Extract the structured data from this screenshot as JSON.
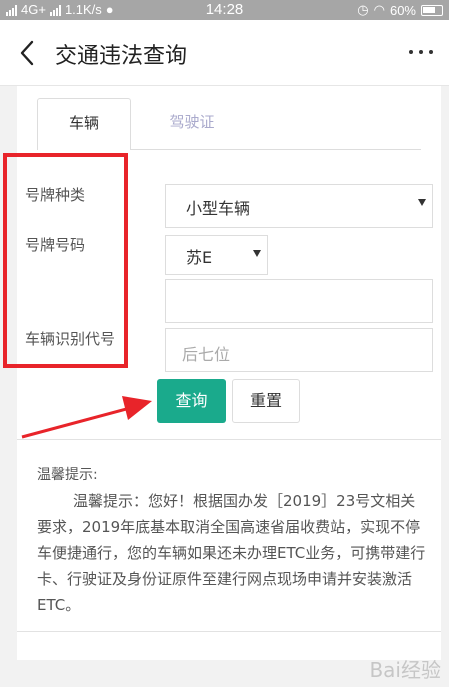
{
  "status": {
    "network": "4G+",
    "speed": "1.1K/s",
    "time": "14:28",
    "battery": "60%"
  },
  "header": {
    "title": "交通违法查询"
  },
  "tabs": [
    {
      "label": "车辆",
      "active": true
    },
    {
      "label": "驾驶证",
      "active": false
    }
  ],
  "form": {
    "plate_type_label": "号牌种类",
    "plate_number_label": "号牌号码",
    "vin_label": "车辆识别代号",
    "plate_type_value": "小型车辆",
    "plate_prefix_value": "苏E",
    "plate_number_value": "",
    "vin_placeholder": "后七位"
  },
  "buttons": {
    "query": "查询",
    "reset": "重置"
  },
  "tips": {
    "title": "温馨提示:",
    "body": "温馨提示：您好！根据国办发［2019］23号文相关要求，2019年底基本取消全国高速省届收费站，实现不停车便捷通行，您的车辆如果还未办理ETC业务，可携带建行卡、行驶证及身份证原件至建行网点现场申请并安装激活ETC。"
  },
  "watermark": "Bai经验",
  "colors": {
    "primary": "#1aaa8c",
    "highlight": "#e8242a",
    "statusbar": "#a6a6a6"
  }
}
